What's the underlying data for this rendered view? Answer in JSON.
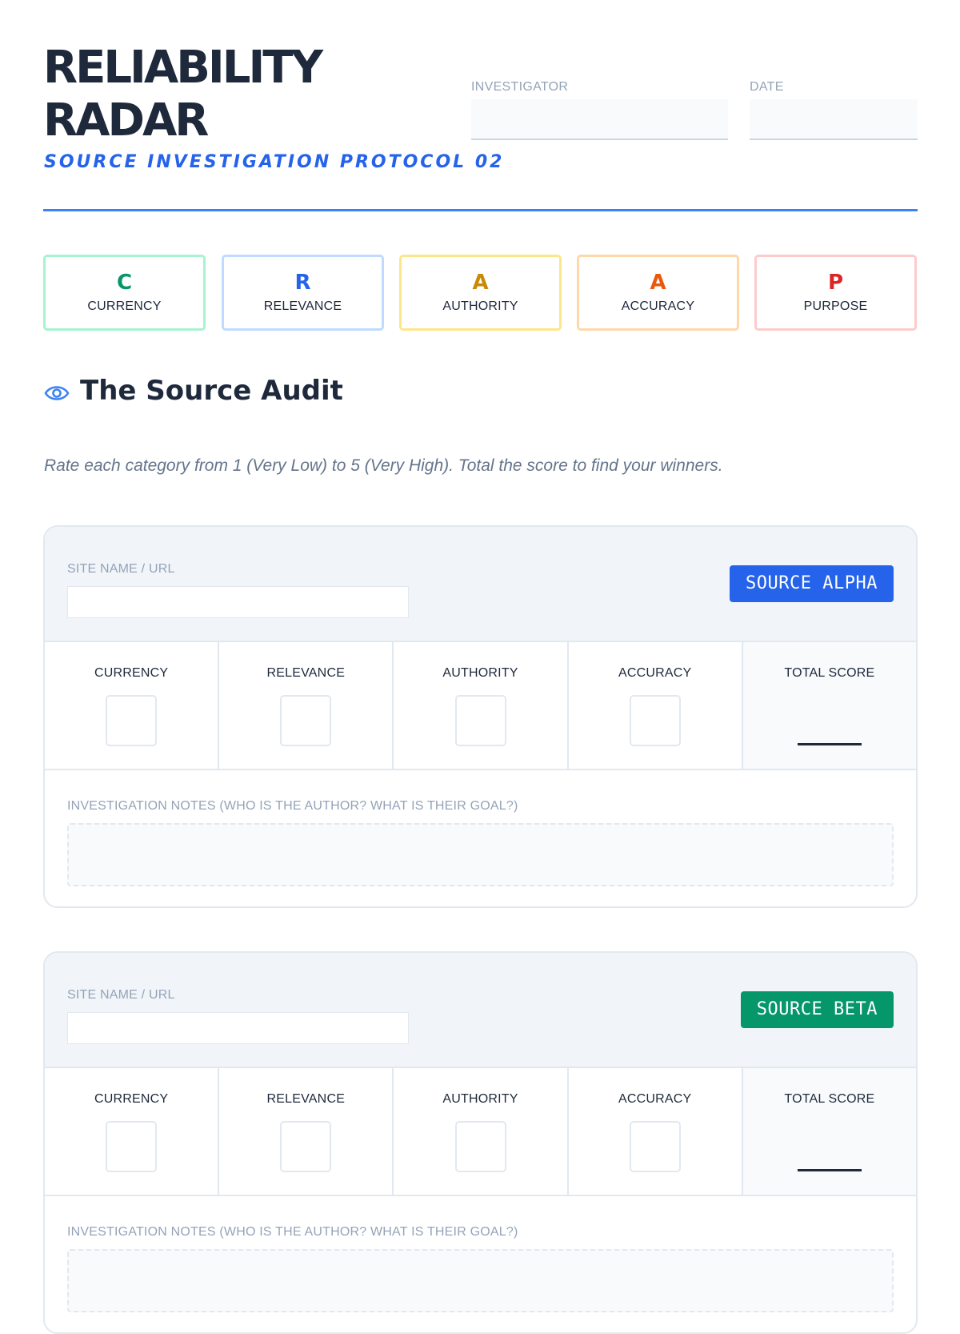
{
  "header": {
    "title_line1": "RELIABILITY",
    "title_line2": "RADAR",
    "subtitle": "SOURCE INVESTIGATION PROTOCOL 02",
    "investigator_label": "INVESTIGATOR",
    "investigator_value": "",
    "date_label": "DATE",
    "date_value": "",
    "rule_color": "#3b82f6"
  },
  "craap": [
    {
      "letter": "C",
      "word": "CURRENCY",
      "color": "#059669",
      "border": "#a7f3d0"
    },
    {
      "letter": "R",
      "word": "RELEVANCE",
      "color": "#2563eb",
      "border": "#bfdbfe"
    },
    {
      "letter": "A",
      "word": "AUTHORITY",
      "color": "#ca8a04",
      "border": "#fde68a"
    },
    {
      "letter": "A",
      "word": "ACCURACY",
      "color": "#ea580c",
      "border": "#fed7aa"
    },
    {
      "letter": "P",
      "word": "PURPOSE",
      "color": "#dc2626",
      "border": "#fecaca"
    }
  ],
  "section": {
    "icon": "eye-icon",
    "title": "The Source Audit",
    "instructions": "Rate each category from 1 (Very Low) to 5 (Very High). Total the score to find your winners."
  },
  "sources": [
    {
      "site_label": "SITE NAME / URL",
      "site_value": "",
      "badge": "SOURCE ALPHA",
      "badge_color": "#2563eb",
      "criteria": [
        "CURRENCY",
        "RELEVANCE",
        "AUTHORITY",
        "ACCURACY"
      ],
      "total_label": "TOTAL SCORE",
      "notes_label": "INVESTIGATION NOTES (WHO IS THE AUTHOR? WHAT IS THEIR GOAL?)"
    },
    {
      "site_label": "SITE NAME / URL",
      "site_value": "",
      "badge": "SOURCE BETA",
      "badge_color": "#059669",
      "criteria": [
        "CURRENCY",
        "RELEVANCE",
        "AUTHORITY",
        "ACCURACY"
      ],
      "total_label": "TOTAL SCORE",
      "notes_label": "INVESTIGATION NOTES (WHO IS THE AUTHOR? WHAT IS THEIR GOAL?)"
    }
  ]
}
